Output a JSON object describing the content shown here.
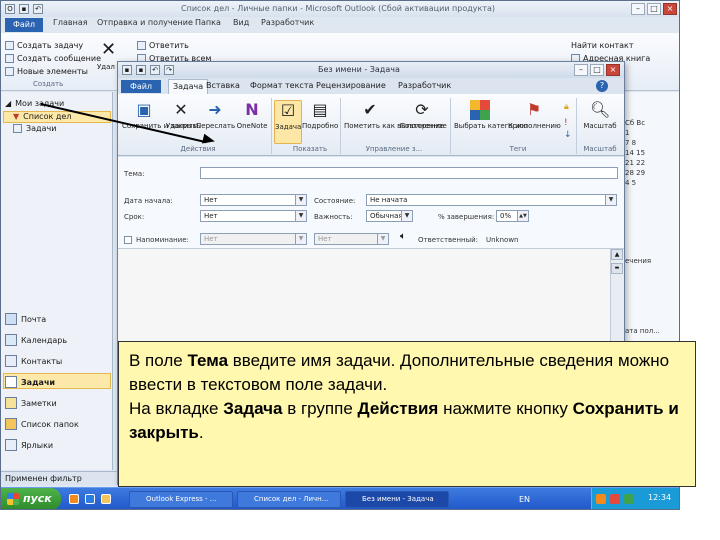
{
  "outlook": {
    "title": "Список дел - Личные папки - Microsoft Outlook (Сбой активации продукта)",
    "file_tab": "Файл",
    "tabs": [
      "Главная",
      "Отправка и получение",
      "Папка",
      "Вид",
      "Разработчик"
    ],
    "ribbon": {
      "new_task": "Создать задачу",
      "new_message": "Создать сообщение",
      "new_items": "Новые элементы",
      "create_group": "Создать",
      "delete_cut": "Удал",
      "reply": "Ответить",
      "reply_all": "Ответить всем",
      "find_contact": "Найти контакт",
      "address_book": "Адресная книга"
    },
    "nav": {
      "my_tasks": "Мои задачи",
      "todo_list": "Список дел",
      "tasks_folder": "Задачи",
      "mail": "Почта",
      "calendar": "Календарь",
      "contacts": "Контакты",
      "tasks": "Задачи",
      "notes": "Заметки",
      "folder_list": "Список папок",
      "shortcuts": "Ярлыки"
    },
    "status": "Применен фильтр",
    "right_pane": {
      "cal1": "Сб Вс",
      "cal2": "1",
      "cal3": "7 8",
      "cal4": "14 15",
      "cal5": "21 22",
      "cal6": "28 29",
      "cal7": "4 5",
      "label1": "ечения",
      "label2": "ата пол..."
    }
  },
  "task_window": {
    "title": "Без имени - Задача",
    "file_tab": "Файл",
    "tabs": [
      "Задача",
      "Вставка",
      "Формат текста",
      "Рецензирование",
      "Разработчик"
    ],
    "buttons": {
      "save_close": "Сохранить и закрыть",
      "delete": "Удалить",
      "forward": "Переслать",
      "onenote": "OneNote",
      "task": "Задача",
      "details": "Подробно",
      "mark_complete": "Пометить как выполненное",
      "recurrence": "Повторение",
      "categorize": "Выбрать категорию",
      "followup": "К исполнению",
      "zoom": "Масштаб"
    },
    "groups": {
      "actions": "Действия",
      "show": "Показать",
      "manage": "Управление з...",
      "tags": "Теги",
      "zoom": "Масштаб"
    },
    "form": {
      "subject_label": "Тема:",
      "subject_value": "",
      "start_label": "Дата начала:",
      "start_value": "Нет",
      "due_label": "Срок:",
      "due_value": "Нет",
      "status_label": "Состояние:",
      "status_value": "Не начата",
      "priority_label": "Важность:",
      "priority_value": "Обычная",
      "percent_label": "% завершения:",
      "percent_value": "0%",
      "reminder_label": "Напоминание:",
      "reminder_date": "Нет",
      "reminder_time": "Нет",
      "owner_label": "Ответственный:",
      "owner_value": "Unknown"
    }
  },
  "taskbar": {
    "start": "пуск",
    "items": [
      "Outlook Express - ...",
      "Список дел - Личн...",
      "Без имени - Задача"
    ],
    "lang": "EN",
    "clock": "12:34"
  },
  "callout": {
    "p1_a": "В поле ",
    "p1_b": "Тема",
    "p1_c": " введите имя задачи. Дополнительные сведения можно ввести в текстовом поле задачи.",
    "p2_a": "На вкладке ",
    "p2_b": "Задача",
    "p2_c": " в группе ",
    "p2_d": "Действия",
    "p2_e": " нажмите кнопку ",
    "p2_f": "Сохранить и закрыть",
    "p2_g": "."
  }
}
